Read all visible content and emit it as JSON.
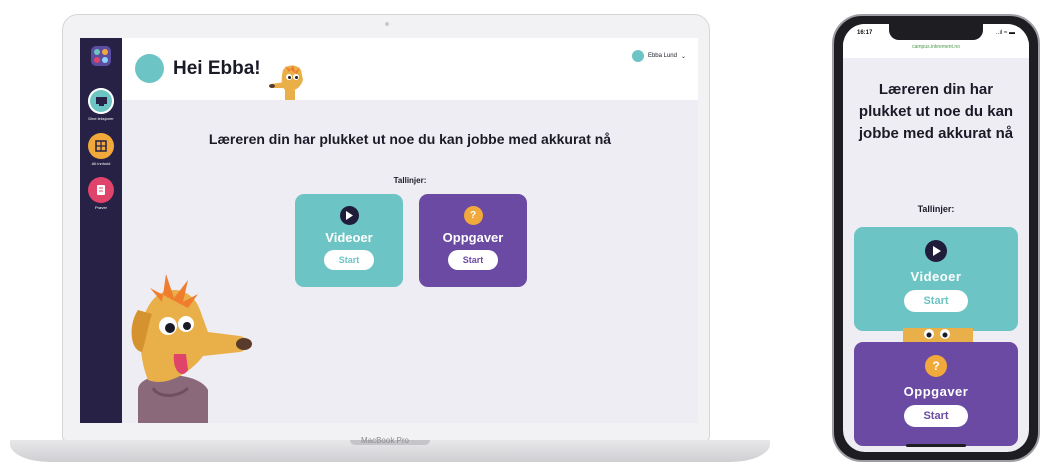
{
  "laptop": {
    "brand": "MacBook Pro",
    "sidebar": {
      "items": [
        {
          "label": "Dine leksjoner",
          "icon": "lesson-icon",
          "color": "#6dc4c4"
        },
        {
          "label": "Alt innhold",
          "icon": "grid-icon",
          "color": "#f2a93b"
        },
        {
          "label": "Prøver",
          "icon": "test-icon",
          "color": "#e0446b"
        }
      ]
    },
    "header": {
      "greeting": "Hei Ebba!",
      "user_name": "Ebba Lund",
      "chevron": "⌄"
    },
    "main": {
      "heading": "Læreren din har plukket ut noe du kan jobbe med akkurat nå",
      "topic_label": "Tallinjer:",
      "cards": [
        {
          "title": "Videoer",
          "button": "Start",
          "icon": "play-icon",
          "color": "#6dc4c4"
        },
        {
          "title": "Oppgaver",
          "button": "Start",
          "icon": "question-icon",
          "color": "#6a4aa3"
        }
      ]
    }
  },
  "phone": {
    "status": {
      "time": "16:17",
      "icons": "..ıl ≈ ▬"
    },
    "url": "campus.inkrement.no",
    "heading": "Læreren din har plukket ut noe du kan jobbe med akkurat nå",
    "topic_label": "Tallinjer:",
    "cards": [
      {
        "title": "Videoer",
        "button": "Start",
        "icon": "play-icon",
        "color": "#6dc4c4"
      },
      {
        "title": "Oppgaver",
        "button": "Start",
        "icon": "question-icon",
        "color": "#6a4aa3"
      }
    ]
  },
  "colors": {
    "teal": "#6dc4c4",
    "purple": "#6a4aa3",
    "sidebar": "#262145",
    "orange": "#f2a93b",
    "pink": "#e0446b"
  }
}
